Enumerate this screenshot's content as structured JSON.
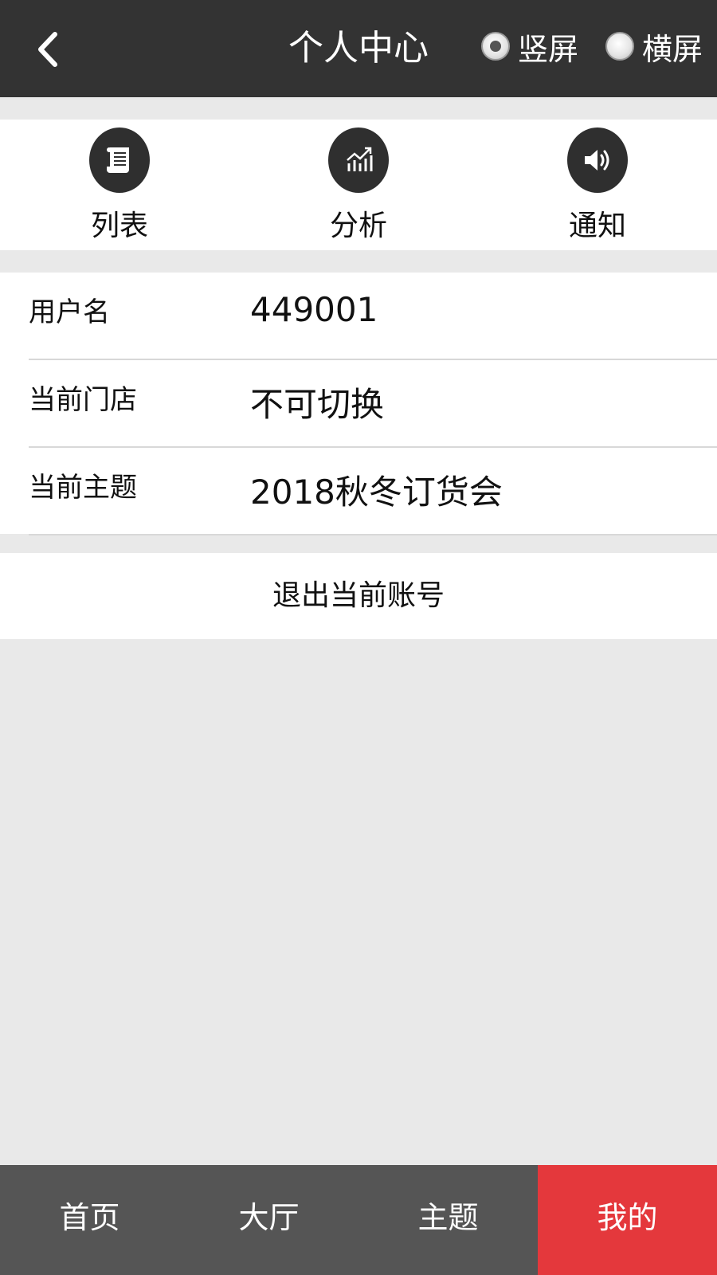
{
  "header": {
    "title": "个人中心",
    "orientation": {
      "portrait_label": "竖屏",
      "landscape_label": "横屏",
      "selected": "portrait"
    }
  },
  "quick_actions": [
    {
      "label": "列表",
      "icon": "scroll-list-icon"
    },
    {
      "label": "分析",
      "icon": "chart-analysis-icon"
    },
    {
      "label": "通知",
      "icon": "speaker-icon"
    }
  ],
  "info": {
    "username_label": "用户名",
    "username_value": "449001",
    "store_label": "当前门店",
    "store_value": "不可切换",
    "theme_label": "当前主题",
    "theme_value": "2018秋冬订货会"
  },
  "logout_label": "退出当前账号",
  "bottom_nav": [
    {
      "label": "首页"
    },
    {
      "label": "大厅"
    },
    {
      "label": "主题"
    },
    {
      "label": "我的",
      "active": true
    }
  ],
  "colors": {
    "header_bg": "#333333",
    "nav_bg": "#555555",
    "nav_active": "#e4383c",
    "page_bg": "#e9e9e9"
  }
}
